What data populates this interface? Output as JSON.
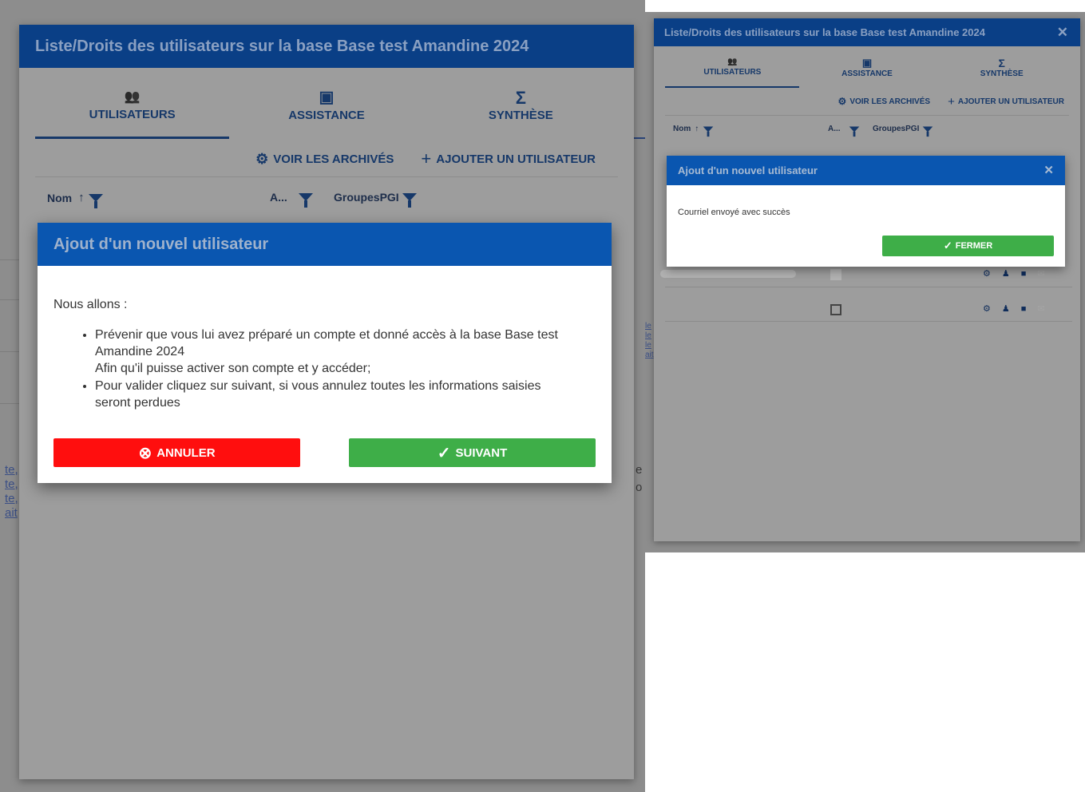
{
  "window_title": "Liste/Droits des utilisateurs sur la base Base test Amandine 2024",
  "close_symbol": "✕",
  "tabs": [
    {
      "label": "UTILISATEURS",
      "icon": "users-icon",
      "glyph": "👥"
    },
    {
      "label": "ASSISTANCE",
      "icon": "chart-icon",
      "glyph": "▣"
    },
    {
      "label": "SYNTHÈSE",
      "icon": "sigma-icon",
      "glyph": "Σ"
    }
  ],
  "toolbar": {
    "archives_label": "VOIR LES ARCHIVÉS",
    "add_user_label": "AJOUTER UN UTILISATEUR",
    "archives_icon": "gear-icon",
    "add_icon": "plus-icon",
    "archives_glyph": "⚙",
    "add_glyph": "+"
  },
  "columns": {
    "name": "Nom",
    "sort_glyph": "↑",
    "admin": "A...",
    "groups": "GroupesPGI"
  },
  "background_links": [
    "te,",
    "te,",
    "te,",
    "ait"
  ],
  "background_fragments": {
    "left_e": "e",
    "left_o": "o",
    "right_links": [
      "le",
      "le",
      "le",
      "ait"
    ]
  },
  "modal_step": {
    "title": "Ajout d'un nouvel utilisateur",
    "intro": "Nous allons :",
    "bullets": [
      {
        "line1": "Prévenir que vous lui avez préparé un compte et donné accès à la base Base test Amandine 2024",
        "line2": "Afin qu'il puisse activer son compte et y accéder;"
      },
      {
        "line1": "Pour valider cliquez sur suivant, si vous annulez toutes les informations saisies seront perdues",
        "line2": ""
      }
    ],
    "cancel_label": "ANNULER",
    "cancel_glyph": "⊗",
    "next_label": "SUIVANT",
    "next_glyph": "✓"
  },
  "modal_done": {
    "title": "Ajout d'un nouvel utilisateur",
    "message": "Courriel envoyé avec succès",
    "close_label": "FERMER",
    "close_glyph": "✓"
  },
  "rows": [
    {
      "checked": true
    },
    {
      "checked": false
    }
  ],
  "row_icons": {
    "gear": "⚙",
    "user": "♟",
    "trash": "■",
    "mail": "✉"
  },
  "colors": {
    "header": "#0a3f86",
    "modal_header": "#0a56b0",
    "primary_text": "#163869",
    "cancel": "#ff0e0e",
    "success": "#3eae48"
  }
}
